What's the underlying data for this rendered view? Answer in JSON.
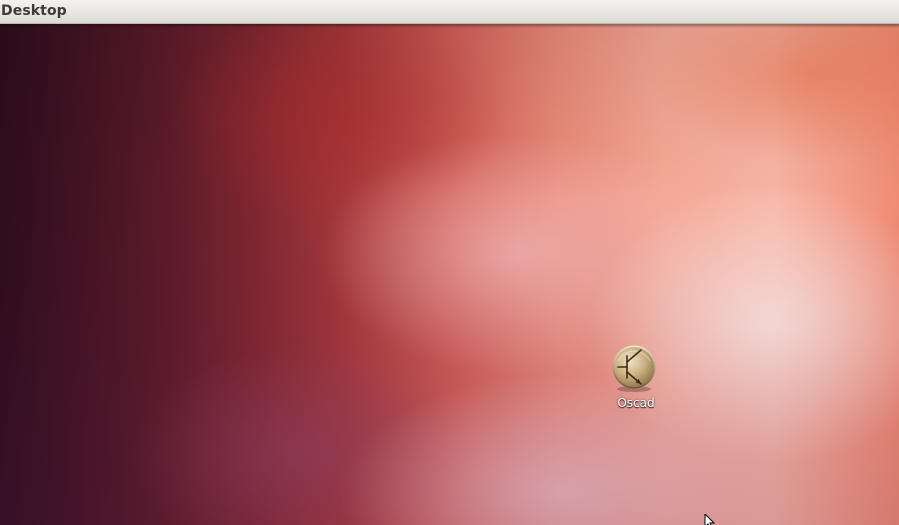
{
  "topbar": {
    "title": "Desktop"
  },
  "desktop": {
    "icons": [
      {
        "label": "Oscad",
        "icon": "transistor-icon"
      }
    ]
  },
  "cursor": {
    "icon": "arrow-cursor-icon"
  }
}
